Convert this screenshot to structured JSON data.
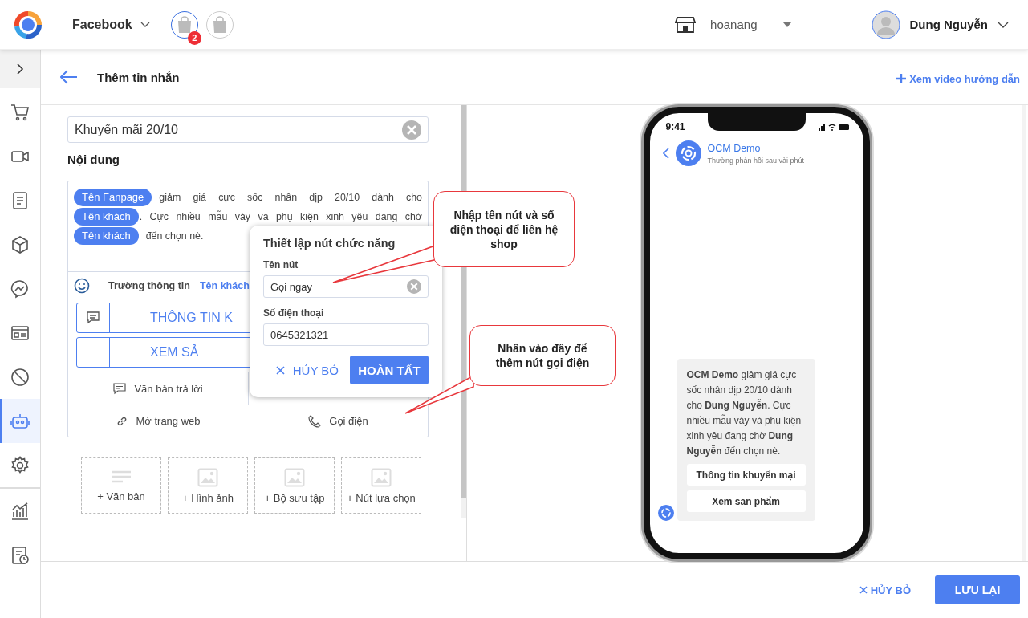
{
  "top_bar": {
    "channel": "Facebook",
    "shops": [
      {
        "selected": true,
        "badge": "2"
      },
      {
        "selected": false
      }
    ],
    "store": "hoanang",
    "user": "Dung Nguyễn"
  },
  "sidebar": {
    "items": [
      {
        "kind": "cart",
        "selected": false
      },
      {
        "kind": "video",
        "selected": false
      },
      {
        "kind": "document",
        "selected": false
      },
      {
        "kind": "box",
        "selected": false
      },
      {
        "kind": "messenger",
        "selected": false
      },
      {
        "kind": "card",
        "selected": false
      },
      {
        "kind": "block",
        "selected": false
      },
      {
        "kind": "bot",
        "selected": true
      },
      {
        "kind": "gear",
        "selected": false
      },
      {
        "kind": "chart",
        "selected": false
      },
      {
        "kind": "report",
        "selected": false
      }
    ]
  },
  "header": {
    "title": "Thêm tin nhắn",
    "help_link": "Xem video hướng dẫn"
  },
  "editor": {
    "name_value": "Khuyến mãi 20/10",
    "content_label": "Nội dung",
    "content": [
      {
        "chip": "Tên Fanpage",
        "text": "giảm giá cực sốc nhân dịp 20/10 dành cho"
      },
      {
        "chip": "Tên khách",
        "text": ". Cực nhiều mẫu váy và phụ kiện xinh yêu đang chờ"
      },
      {
        "chip": "Tên khách",
        "text": "đến chọn nè."
      }
    ],
    "field_label": "Trường thông tin",
    "field_chip": "Tên khách",
    "reply_buttons": [
      {
        "label": "THÔNG TIN K",
        "icon": true
      },
      {
        "label": "XEM SẢ",
        "icon": false
      }
    ],
    "options": [
      {
        "kind": "reply",
        "label": "Văn bản trả lời"
      },
      {
        "kind": "web",
        "label": "Mở trang web"
      },
      {
        "kind": "call",
        "label": "Gọi điện"
      }
    ],
    "add_tiles": [
      {
        "kind": "text",
        "label": "+ Văn bản"
      },
      {
        "kind": "image",
        "label": "+ Hình ảnh"
      },
      {
        "kind": "image",
        "label": "+ Bộ sưu tập"
      },
      {
        "kind": "image",
        "label": "+ Nút lựa chọn"
      }
    ]
  },
  "popup": {
    "title": "Thiết lập nút chức năng",
    "name_label": "Tên nút",
    "name_value": "Gọi ngay",
    "phone_label": "Số điện thoại",
    "phone_value": "0645321321",
    "cancel": "HỦY BỎ",
    "confirm": "HOÀN TẤT"
  },
  "preview": {
    "time": "9:41",
    "page_name": "OCM Demo",
    "status": "Thường phản hồi sau vài phút",
    "message": "**OCM Demo** giảm giá cực sốc nhân dịp 20/10 dành cho **Dung Nguyễn**. Cực nhiều mẫu váy và phụ kiện xinh yêu đang chờ **Dung Nguyễn** đến chọn nè.",
    "buttons": [
      "Thông tin khuyến mại",
      "Xem sản phẩm"
    ]
  },
  "callouts": [
    {
      "text": "Nhập tên nút và số điện thoại để liên hệ shop"
    },
    {
      "text": "Nhấn vào đây để thêm nút gọi điện"
    }
  ],
  "footer": {
    "cancel": "HỦY BỎ",
    "save": "LƯU LẠI"
  }
}
